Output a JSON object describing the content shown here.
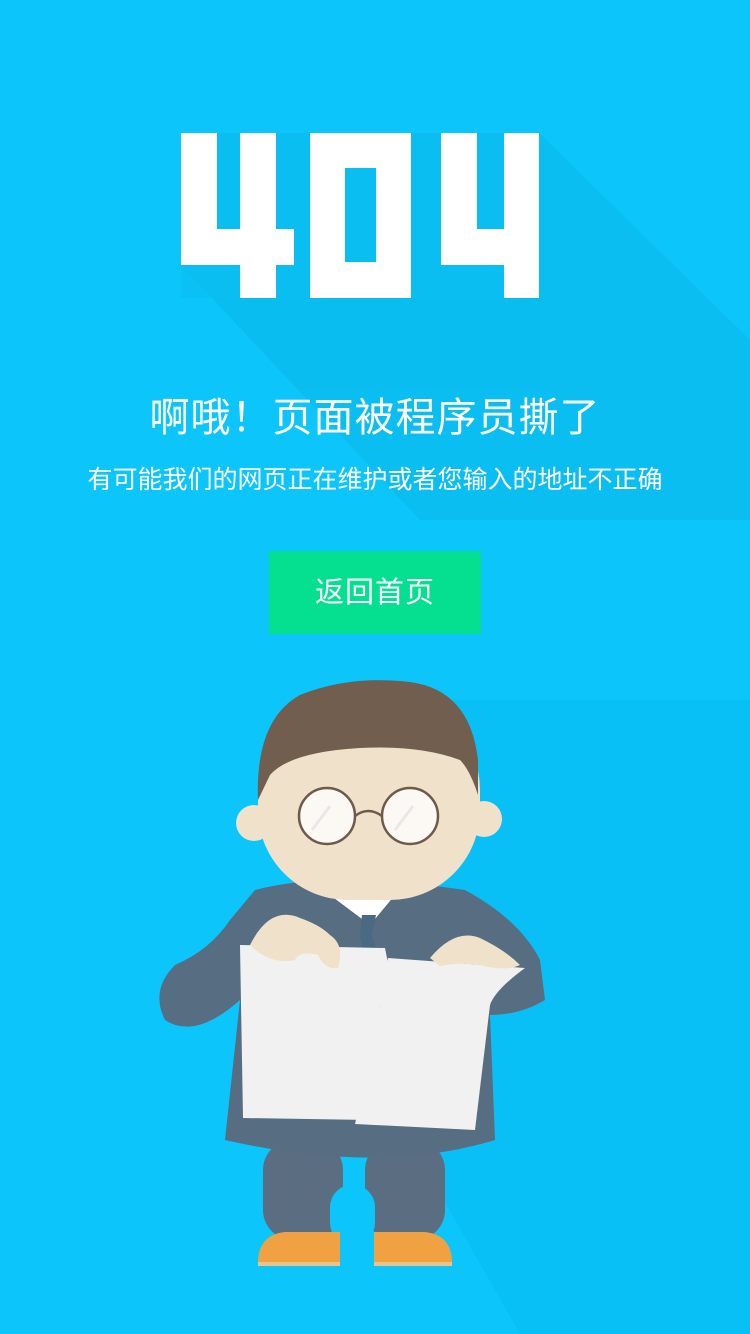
{
  "error_code": "404",
  "message": {
    "title": "啊哦！页面被程序员撕了",
    "subtitle": "有可能我们的网页正在维护或者您输入的地址不正确"
  },
  "actions": {
    "home_label": "返回首页"
  },
  "colors": {
    "background": "#0bc5fb",
    "button": "#04e090",
    "text": "#ffffff"
  }
}
